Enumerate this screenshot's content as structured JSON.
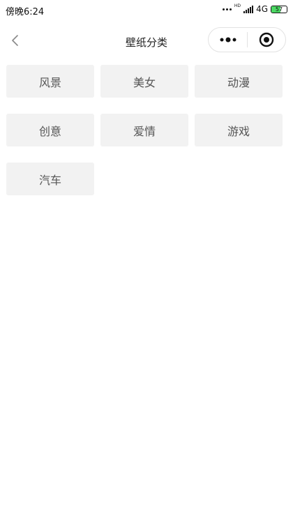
{
  "status_bar": {
    "time": "傍晚6:24",
    "network": "4G",
    "hd_label": "HD",
    "battery_level": "57",
    "battery_color": "#4cd964"
  },
  "nav": {
    "title": "壁纸分类",
    "back_icon": "chevron-left",
    "more_icon": "more-dots",
    "close_icon": "target-circle"
  },
  "categories": [
    {
      "label": "风景"
    },
    {
      "label": "美女"
    },
    {
      "label": "动漫"
    },
    {
      "label": "创意"
    },
    {
      "label": "爱情"
    },
    {
      "label": "游戏"
    },
    {
      "label": "汽车"
    }
  ]
}
